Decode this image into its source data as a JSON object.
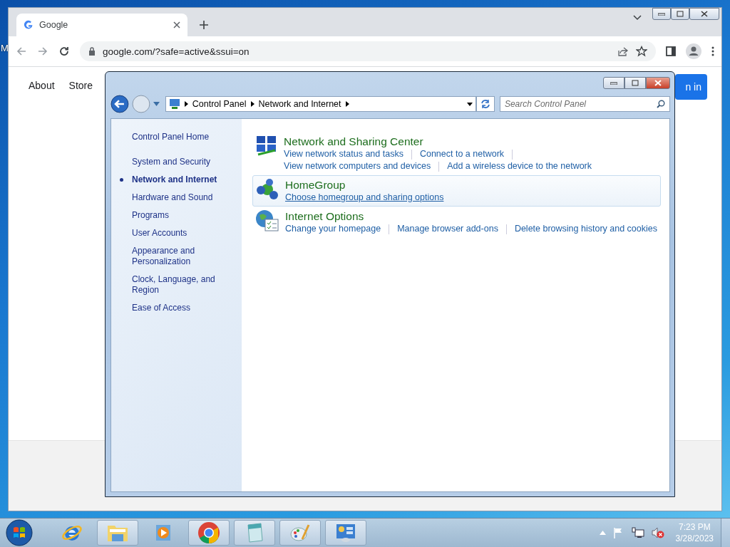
{
  "desktop_icons": [
    {
      "label": "M"
    }
  ],
  "browser": {
    "tab_title": "Google",
    "url": "google.com/?safe=active&ssui=on",
    "page_links": [
      "About",
      "Store"
    ],
    "sign_in": "n in"
  },
  "control_panel": {
    "breadcrumb": [
      "Control Panel",
      "Network and Internet"
    ],
    "search": {
      "placeholder": "Search Control Panel"
    },
    "sidebar": [
      {
        "label": "Control Panel Home",
        "kind": "home",
        "selected": false
      },
      {
        "label": "System and Security",
        "kind": "category",
        "selected": false
      },
      {
        "label": "Network and Internet",
        "kind": "category",
        "selected": true
      },
      {
        "label": "Hardware and Sound",
        "kind": "category",
        "selected": false
      },
      {
        "label": "Programs",
        "kind": "category",
        "selected": false
      },
      {
        "label": "User Accounts",
        "kind": "category",
        "selected": false
      },
      {
        "label": "Appearance and Personalization",
        "kind": "category",
        "selected": false
      },
      {
        "label": "Clock, Language, and Region",
        "kind": "category",
        "selected": false
      },
      {
        "label": "Ease of Access",
        "kind": "category",
        "selected": false
      }
    ],
    "categories": [
      {
        "title": "Network and Sharing Center",
        "kind": "network",
        "hovered": false,
        "link_rows": [
          [
            "View network status and tasks",
            "Connect to a network"
          ],
          [
            "View network computers and devices",
            "Add a wireless device to the network"
          ]
        ]
      },
      {
        "title": "HomeGroup",
        "kind": "homegroup",
        "hovered": true,
        "link_rows": [
          [
            "Choose homegroup and sharing options"
          ]
        ]
      },
      {
        "title": "Internet Options",
        "kind": "internet",
        "hovered": false,
        "link_rows": [
          [
            "Change your homepage",
            "Manage browser add-ons",
            "Delete browsing history and cookies"
          ]
        ]
      }
    ]
  },
  "taskbar": {
    "apps": [
      {
        "kind": "ie",
        "running": false
      },
      {
        "kind": "explorer",
        "running": true
      },
      {
        "kind": "media",
        "running": false
      },
      {
        "kind": "chrome",
        "running": true
      },
      {
        "kind": "notepad",
        "running": true
      },
      {
        "kind": "paint",
        "running": true
      },
      {
        "kind": "controlpanel",
        "running": true
      }
    ],
    "clock": {
      "time": "7:23 PM",
      "date": "3/28/2023"
    }
  }
}
